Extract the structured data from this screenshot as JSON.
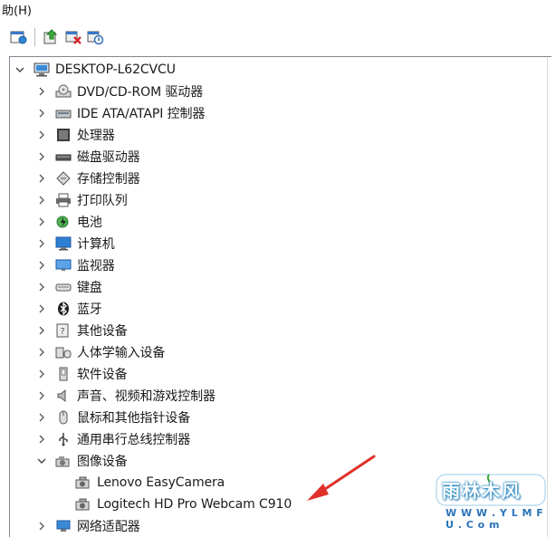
{
  "menubar": {
    "help_label": "助(H)"
  },
  "toolbar": {
    "buttons": [
      "scan-hardware-icon",
      "update-driver-icon",
      "uninstall-device-icon",
      "disable-device-icon"
    ]
  },
  "tree": {
    "root": {
      "label": "DESKTOP-L62CVCU",
      "expanded": true
    },
    "categories": [
      {
        "label": "DVD/CD-ROM 驱动器",
        "icon": "dvd-drive-icon"
      },
      {
        "label": "IDE ATA/ATAPI 控制器",
        "icon": "ide-controller-icon"
      },
      {
        "label": "处理器",
        "icon": "processor-icon"
      },
      {
        "label": "磁盘驱动器",
        "icon": "disk-drive-icon"
      },
      {
        "label": "存储控制器",
        "icon": "storage-controller-icon"
      },
      {
        "label": "打印队列",
        "icon": "printer-icon"
      },
      {
        "label": "电池",
        "icon": "battery-icon"
      },
      {
        "label": "计算机",
        "icon": "computer-icon"
      },
      {
        "label": "监视器",
        "icon": "monitor-icon"
      },
      {
        "label": "键盘",
        "icon": "keyboard-icon"
      },
      {
        "label": "蓝牙",
        "icon": "bluetooth-icon"
      },
      {
        "label": "其他设备",
        "icon": "other-devices-icon"
      },
      {
        "label": "人体学输入设备",
        "icon": "hid-icon"
      },
      {
        "label": "软件设备",
        "icon": "software-device-icon"
      },
      {
        "label": "声音、视频和游戏控制器",
        "icon": "sound-icon"
      },
      {
        "label": "鼠标和其他指针设备",
        "icon": "mouse-icon"
      },
      {
        "label": "通用串行总线控制器",
        "icon": "usb-icon"
      },
      {
        "label": "图像设备",
        "icon": "imaging-device-icon",
        "expanded": true,
        "children": [
          "Lenovo EasyCamera",
          "Logitech HD Pro Webcam C910"
        ]
      },
      {
        "label": "网络适配器",
        "icon": "network-adapter-icon"
      }
    ]
  },
  "watermark": {
    "logo_text": "雨林木风",
    "url": "W W W . Y L M F U . C o m"
  },
  "colors": {
    "tree_border": "#828790",
    "arrow": "#e0302a",
    "chevron": "#555555"
  }
}
